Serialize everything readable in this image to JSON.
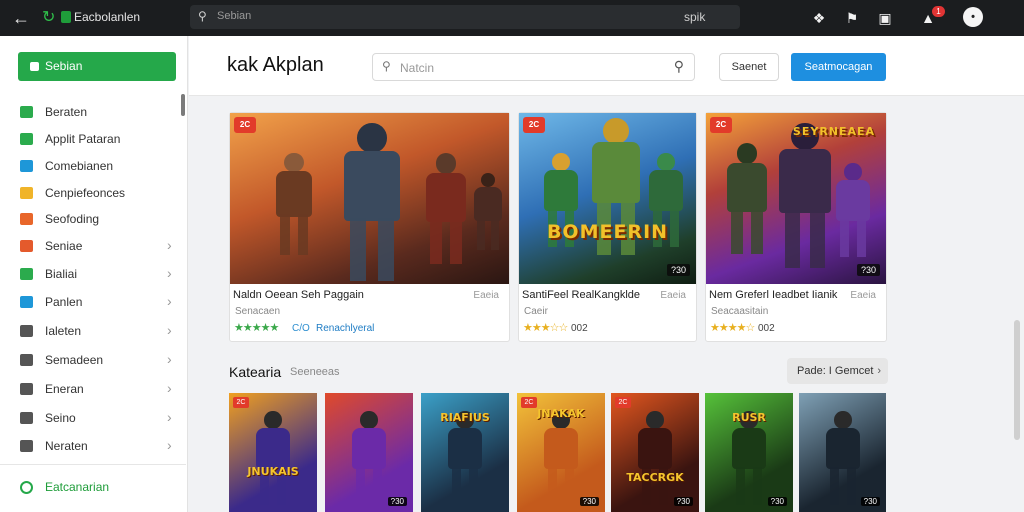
{
  "topbar": {
    "app_title": "Eacbolanlen",
    "search_placeholder": "Sebian",
    "search_value": "spik",
    "notification_count": "1",
    "avatar_initial": "•",
    "icons": [
      "back-arrow-icon",
      "forward-icon",
      "puzzle-icon",
      "bookmark-icon",
      "download-icon",
      "bell-icon",
      "avatar"
    ]
  },
  "sidebar": {
    "primary_button": "Sebian",
    "items": [
      {
        "label": "Beraten",
        "color": "#2bab4d",
        "chevron": false
      },
      {
        "label": "Applit Pataran",
        "color": "#2bab4d",
        "chevron": false
      },
      {
        "label": "Comebianen",
        "color": "#1e97d8",
        "chevron": false
      },
      {
        "label": "Cenpiefeonces",
        "color": "#f0b429",
        "chevron": false
      },
      {
        "label": "Seofoding",
        "color": "#e8662a",
        "chevron": false
      },
      {
        "label": "Seniae",
        "color": "#e45a2c",
        "chevron": true
      },
      {
        "label": "Bialiai",
        "color": "#2bab4d",
        "chevron": true
      },
      {
        "label": "Panlen",
        "color": "#1e97d8",
        "chevron": true
      },
      {
        "label": "Ialeten",
        "color": "#555555",
        "chevron": true
      },
      {
        "label": "Semadeen",
        "color": "#555555",
        "chevron": true
      },
      {
        "label": "Eneran",
        "color": "#555555",
        "chevron": true
      },
      {
        "label": "Seino",
        "color": "#555555",
        "chevron": true
      },
      {
        "label": "Neraten",
        "color": "#555555",
        "chevron": true
      }
    ],
    "bottom_item": "Eatcanarian"
  },
  "header": {
    "logo_text": "kak Akplan",
    "search_placeholder": "Natcin",
    "secondary_button": "Saenet",
    "primary_button": "Seatmocagan"
  },
  "featured": [
    {
      "tag": "2C",
      "title": "Naldn Oeean Seh Paggain",
      "price": "Eaeia",
      "subtitle": "Senacaen",
      "stars": "★★★★★",
      "rating": "C/O",
      "extra": "Renachlyeral",
      "badge": "",
      "game_title": "",
      "accent": "#d9652b"
    },
    {
      "tag": "2C",
      "title": "SantiFeel RealKangklde",
      "price": "Eaeia",
      "subtitle": "Caeir",
      "stars": "★★★☆☆",
      "rating": "002",
      "extra": "",
      "badge": "?30",
      "game_title": "BOMEERIN",
      "accent": "#2c7fd0"
    },
    {
      "tag": "2C",
      "title": "Nem Greferl Ieadbet Iianik",
      "price": "Eaeia",
      "subtitle": "Seacaasitain",
      "stars": "★★★★☆",
      "rating": "002",
      "extra": "",
      "badge": "?30",
      "game_title": "SEYRNEAEA",
      "accent": "#8a3cc9"
    }
  ],
  "section": {
    "title": "Katearia",
    "subtitle": "Seeneeas",
    "button": "Pade: I Gemcet"
  },
  "tiles": [
    {
      "label": "JNUKAIS",
      "badge": "",
      "tag": "2C",
      "color1": "#3b2a8a",
      "color2": "#f0a020"
    },
    {
      "label": "",
      "badge": "?30",
      "tag": "",
      "color1": "#6b2aa8",
      "color2": "#e04a2a"
    },
    {
      "label": "RIAFIUS",
      "badge": "",
      "tag": "",
      "color1": "#1b2f45",
      "color2": "#3ba0c8"
    },
    {
      "label": "JNAKAK",
      "badge": "?30",
      "tag": "2C",
      "color1": "#c45a1c",
      "color2": "#f2c23a"
    },
    {
      "label": "TACCRGK",
      "badge": "?30",
      "tag": "2C",
      "color1": "#3a1410",
      "color2": "#e2561f"
    },
    {
      "label": "RUSR",
      "badge": "?30",
      "tag": "",
      "color1": "#1a3a16",
      "color2": "#56c23a"
    },
    {
      "label": "",
      "badge": "?30",
      "tag": "",
      "color1": "#1a2530",
      "color2": "#7fa0b5"
    }
  ]
}
